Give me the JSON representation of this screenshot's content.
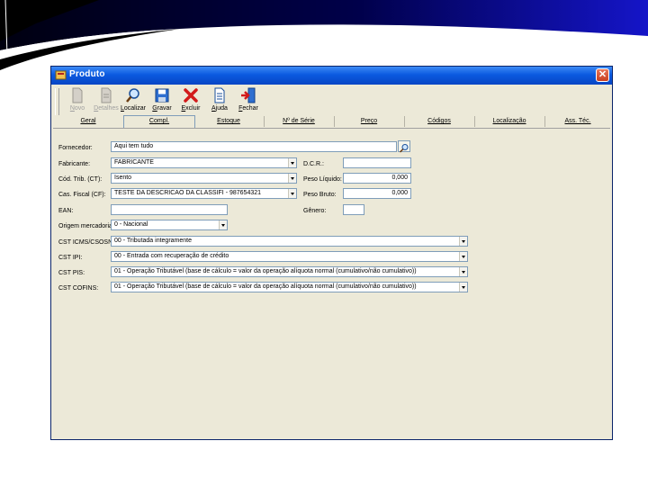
{
  "window": {
    "title": "Produto",
    "close_glyph": "✕"
  },
  "toolbar": {
    "buttons": [
      {
        "label": "Novo",
        "icon": "new-document-icon",
        "enabled": false
      },
      {
        "label": "Detalhes",
        "icon": "details-document-icon",
        "enabled": false
      },
      {
        "label": "Localizar",
        "icon": "search-icon",
        "enabled": true
      },
      {
        "label": "Gravar",
        "icon": "save-icon",
        "enabled": true
      },
      {
        "label": "Excluir",
        "icon": "delete-icon",
        "enabled": true
      },
      {
        "label": "Ajuda",
        "icon": "help-icon",
        "enabled": true
      },
      {
        "label": "Fechar",
        "icon": "exit-icon",
        "enabled": true
      }
    ]
  },
  "tabs": [
    {
      "label": "Geral"
    },
    {
      "label": "Compl."
    },
    {
      "label": "Estoque"
    },
    {
      "label": "Nº de Série"
    },
    {
      "label": "Preço"
    },
    {
      "label": "Códigos"
    },
    {
      "label": "Localização"
    },
    {
      "label": "Ass. Téc."
    }
  ],
  "active_tab": "Compl.",
  "form": {
    "fornecedor": {
      "label": "Fornecedor:",
      "value": "Aqui tem tudo"
    },
    "fabricante": {
      "label": "Fabricante:",
      "value": "FABRICANTE"
    },
    "sit_trib": {
      "label": "Cód. Trib. (CT):",
      "value": "Isento"
    },
    "class_fiscal": {
      "label": "Cas. Fiscal (CF):",
      "value": "TESTE DA DESCRICAO DA CLASSIFI - 987654321"
    },
    "ean": {
      "label": "EAN:",
      "value": ""
    },
    "origem": {
      "label": "Origem mercadoria:",
      "value": "0 - Nacional"
    },
    "dcr": {
      "label": "D.C.R.:",
      "value": ""
    },
    "peso_liquido": {
      "label": "Peso Líquido:",
      "value": "0,000"
    },
    "peso_bruto": {
      "label": "Peso Bruto:",
      "value": "0,000"
    },
    "genero": {
      "label": "Gênero:",
      "value": ""
    },
    "cst_icms": {
      "label": "CST ICMS/CSOSN:",
      "value": "00 - Tributada integramente"
    },
    "cst_ipi": {
      "label": "CST IPI:",
      "value": "00 - Entrada com recuperação de crédito"
    },
    "cst_pis": {
      "label": "CST PIS:",
      "value": "01 - Operação Tributável (base de cálculo = valor da operação alíquota normal (cumulativo/não cumulativo))"
    },
    "cst_cofins": {
      "label": "CST COFINS:",
      "value": "01 - Operação Tributável (base de cálculo = valor da operação alíquota normal (cumulativo/não cumulativo))"
    }
  },
  "colors": {
    "titlebar": "#0b5ae0",
    "window_bg": "#ece9d8",
    "swoosh": "#000080"
  }
}
